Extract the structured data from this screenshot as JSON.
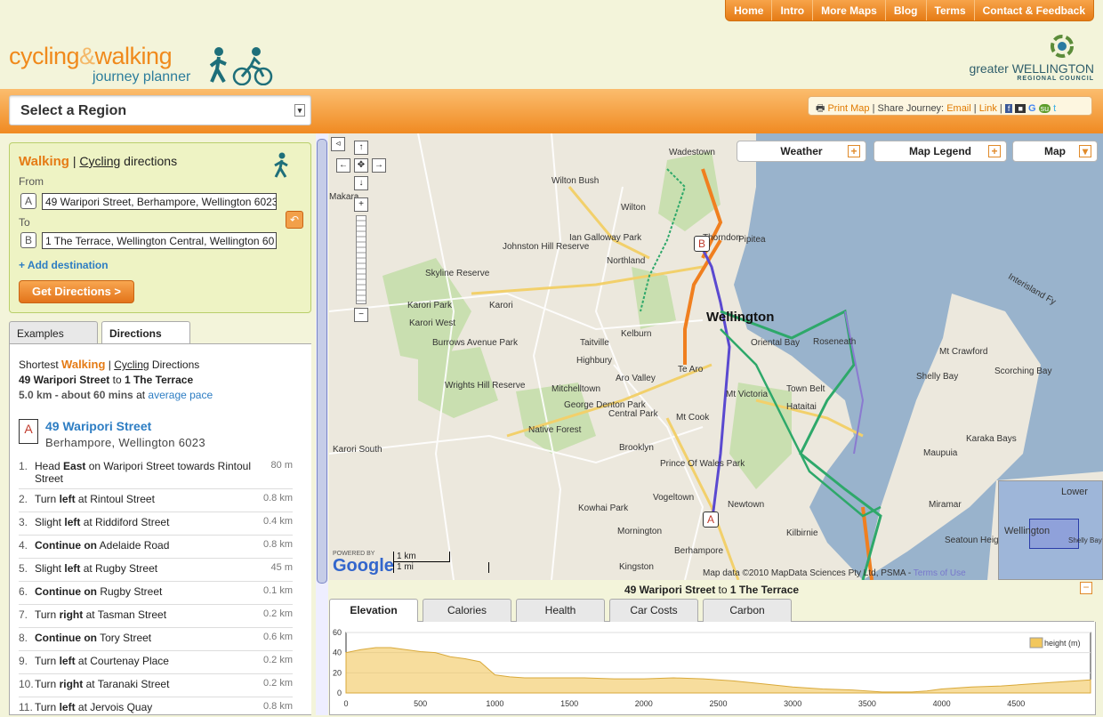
{
  "nav": [
    "Home",
    "Intro",
    "More Maps",
    "Blog",
    "Terms",
    "Contact & Feedback"
  ],
  "brand": {
    "line1_a": "cycling",
    "line1_amp": "&",
    "line1_b": "walking",
    "line2": "journey planner"
  },
  "council": {
    "name_a": "greater",
    "name_b": "WELLINGTON",
    "sub": "REGIONAL COUNCIL"
  },
  "region": {
    "label": "Select a Region"
  },
  "share": {
    "print": "Print Map",
    "share_label": "Share Journey:",
    "email": "Email",
    "link": "Link"
  },
  "planner": {
    "mode_active": "Walking",
    "mode_other": "Cycling",
    "title_suffix": "directions",
    "from_label": "From",
    "to_label": "To",
    "from_marker": "A",
    "to_marker": "B",
    "from_value": "49 Waripori Street, Berhampore, Wellington 6023",
    "to_value": "1 The Terrace, Wellington Central, Wellington 60",
    "add_destination": "+ Add destination",
    "get_directions": "Get Directions >"
  },
  "tabs": [
    "Examples",
    "Directions"
  ],
  "directions": {
    "prefix": "Shortest",
    "mode": "Walking",
    "other_mode": "Cycling",
    "suffix": "Directions",
    "from": "49 Waripori Street",
    "to_word": "to",
    "to": "1 The Terrace",
    "distance": "5.0 km - about 60 mins",
    "at": "at",
    "pace": "average pace",
    "start_marker": "A",
    "start_name": "49 Waripori Street",
    "start_addr": "Berhampore, Wellington 6023",
    "steps": [
      {
        "n": "1.",
        "a": "Head ",
        "b": "East",
        "c": " on Waripori Street towards Rintoul Street",
        "d": "80 m"
      },
      {
        "n": "2.",
        "a": "Turn ",
        "b": "left",
        "c": " at Rintoul Street",
        "d": "0.8 km"
      },
      {
        "n": "3.",
        "a": "Slight ",
        "b": "left",
        "c": " at Riddiford Street",
        "d": "0.4 km"
      },
      {
        "n": "4.",
        "a": "",
        "b": "Continue on",
        "c": " Adelaide Road",
        "d": "0.8 km"
      },
      {
        "n": "5.",
        "a": "Slight ",
        "b": "left",
        "c": " at Rugby Street",
        "d": "45 m"
      },
      {
        "n": "6.",
        "a": "",
        "b": "Continue on",
        "c": " Rugby Street",
        "d": "0.1 km"
      },
      {
        "n": "7.",
        "a": "Turn ",
        "b": "right",
        "c": " at Tasman Street",
        "d": "0.2 km"
      },
      {
        "n": "8.",
        "a": "",
        "b": "Continue on",
        "c": " Tory Street",
        "d": "0.6 km"
      },
      {
        "n": "9.",
        "a": "Turn ",
        "b": "left",
        "c": " at Courtenay Place",
        "d": "0.2 km"
      },
      {
        "n": "10.",
        "a": "Turn ",
        "b": "right",
        "c": " at Taranaki Street",
        "d": "0.2 km"
      },
      {
        "n": "11.",
        "a": "Turn ",
        "b": "left",
        "c": " at Jervois Quay",
        "d": "0.8 km"
      }
    ]
  },
  "map": {
    "buttons": [
      "Weather",
      "Map Legend",
      "Map"
    ],
    "labels": [
      "Wadestown",
      "Wilton Bush",
      "Wilton",
      "Thorndon",
      "Pipitea",
      "Johnston Hill Reserve",
      "Ian Galloway Park",
      "Northland",
      "Skyline Reserve",
      "Karori Park",
      "Karori",
      "Karori West",
      "Wellington",
      "Oriental Bay",
      "Roseneath",
      "Kelburn",
      "Taitville",
      "Highbury",
      "Te Aro",
      "Burrows Avenue Park",
      "Wrights Hill Reserve",
      "Mitchelltown",
      "Aro Valley",
      "Mt Victoria",
      "Town Belt",
      "George Denton Park",
      "Central Park",
      "Mt Cook",
      "Hataitai",
      "Native Forest",
      "Brooklyn",
      "Prince Of Wales Park",
      "Karori South",
      "Vogeltown",
      "Newtown",
      "Kowhai Park",
      "Mornington",
      "Kilbirnie",
      "Kingston",
      "Berhampore",
      "Mt Crawford",
      "Shelly Bay",
      "Scorching Bay",
      "Maupuia",
      "Karaka Bays",
      "Miramar",
      "Seatoun Heights",
      "Makara",
      "Interisland Fy",
      "Lower",
      "Wellington",
      "Shelly Bay"
    ],
    "markers": [
      "A",
      "B"
    ],
    "scale": [
      "1 km",
      "1 mi"
    ],
    "google": "Google",
    "powered": "POWERED BY",
    "copyright": "Map data ©2010 MapData Sciences Pty Ltd, PSMA",
    "terms": "Terms of Use"
  },
  "elevation": {
    "title_from": "49 Waripori Street",
    "title_to_word": "to",
    "title_to": "1 The Terrace",
    "tabs": [
      "Elevation",
      "Calories",
      "Health",
      "Car Costs",
      "Carbon"
    ]
  },
  "chart_data": {
    "type": "area",
    "title": "",
    "xlabel": "",
    "ylabel": "",
    "legend": "height (m)",
    "legend_position": "top-right",
    "xlim": [
      0,
      5000
    ],
    "ylim": [
      0,
      60
    ],
    "xticks": [
      0,
      500,
      1000,
      1500,
      2000,
      2500,
      3000,
      3500,
      4000,
      4500
    ],
    "yticks": [
      0,
      20,
      40,
      60
    ],
    "color": "#f2c75c",
    "x": [
      0,
      100,
      200,
      300,
      400,
      500,
      600,
      700,
      800,
      900,
      1000,
      1100,
      1200,
      1400,
      1600,
      1800,
      2000,
      2200,
      2400,
      2600,
      2800,
      3000,
      3200,
      3400,
      3600,
      3800,
      3900,
      4000,
      4100,
      4200,
      4400,
      4600,
      4800,
      5000
    ],
    "y": [
      40,
      43,
      45,
      45,
      43,
      41,
      40,
      36,
      34,
      31,
      18,
      16,
      15,
      15,
      15,
      14,
      14,
      15,
      14,
      12,
      9,
      6,
      4,
      3,
      1,
      1,
      2,
      4,
      5,
      6,
      7,
      9,
      11,
      13
    ]
  }
}
